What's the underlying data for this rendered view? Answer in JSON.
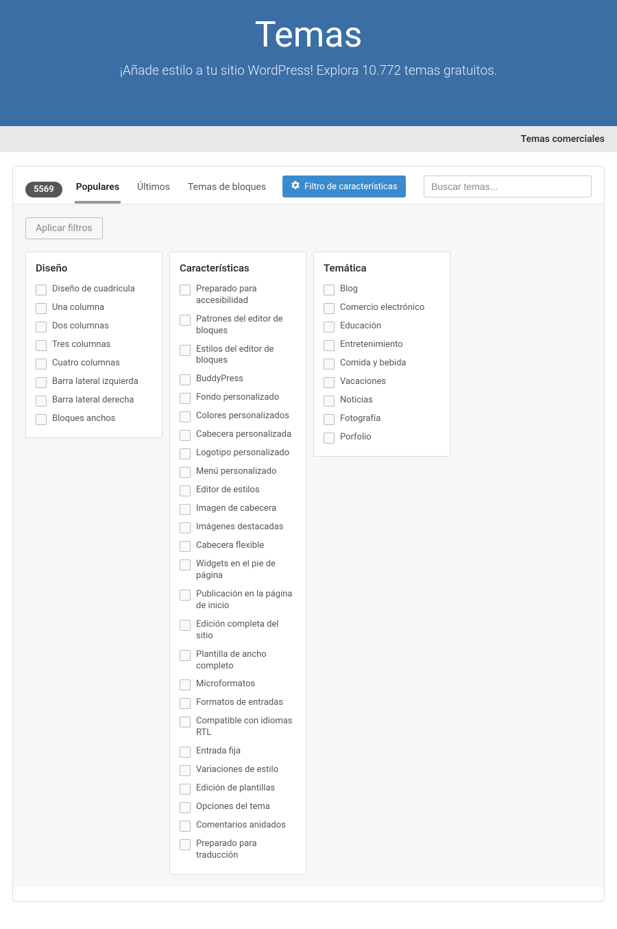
{
  "hero": {
    "title": "Temas",
    "subtitle": "¡Añade estilo a tu sitio WordPress! Explora 10.772 temas gratuitos."
  },
  "subbar": {
    "commercial_link": "Temas comerciales"
  },
  "tabs": {
    "count": "5569",
    "items": [
      {
        "key": "popular",
        "label": "Populares",
        "active": true
      },
      {
        "key": "latest",
        "label": "Últimos",
        "active": false
      },
      {
        "key": "block-themes",
        "label": "Temas de bloques",
        "active": false
      }
    ],
    "feature_filter_label": "Filtro de características"
  },
  "search": {
    "placeholder": "Buscar temas..."
  },
  "filters": {
    "apply_label": "Aplicar filtros",
    "groups": [
      {
        "key": "layout",
        "title": "Diseño",
        "items": [
          "Diseño de cuadrícula",
          "Una columna",
          "Dos columnas",
          "Tres columnas",
          "Cuatro columnas",
          "Barra lateral izquierda",
          "Barra lateral derecha",
          "Bloques anchos"
        ]
      },
      {
        "key": "features",
        "title": "Características",
        "items": [
          "Preparado para accesibilidad",
          "Patrones del editor de bloques",
          "Estilos del editor de bloques",
          "BuddyPress",
          "Fondo personalizado",
          "Colores personalizados",
          "Cabecera personalizada",
          "Logotipo personalizado",
          "Menú personalizado",
          "Editor de estilos",
          "Imagen de cabecera",
          "Imágenes destacadas",
          "Cabecera flexible",
          "Widgets en el pie de página",
          "Publicación en la página de inicio",
          "Edición completa del sitio",
          "Plantilla de ancho completo",
          "Microformatos",
          "Formatos de entradas",
          "Compatible con idiomas RTL",
          "Entrada fija",
          "Variaciones de estilo",
          "Edición de plantillas",
          "Opciones del tema",
          "Comentarios anidados",
          "Preparado para traducción"
        ]
      },
      {
        "key": "subject",
        "title": "Temática",
        "items": [
          "Blog",
          "Comercio electrónico",
          "Educación",
          "Entretenimiento",
          "Comida y bebida",
          "Vacaciones",
          "Noticias",
          "Fotografía",
          "Porfolio"
        ]
      }
    ]
  }
}
